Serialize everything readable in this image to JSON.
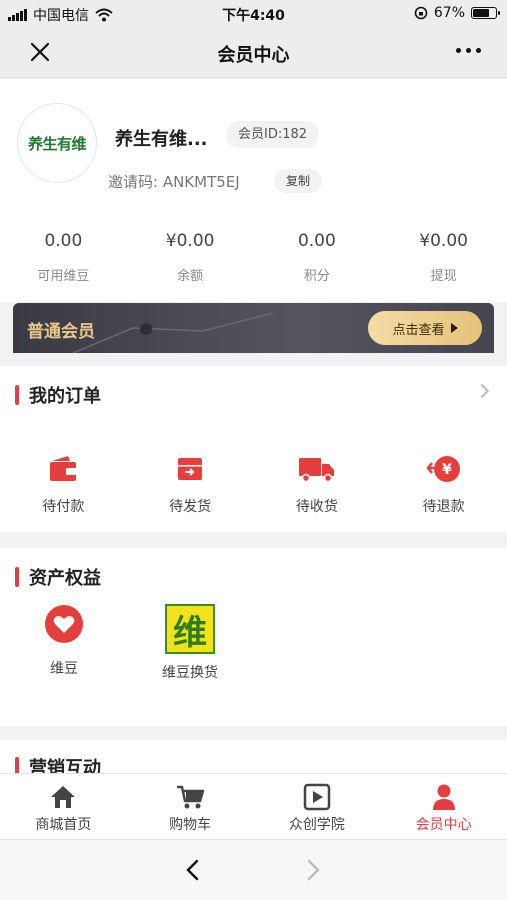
{
  "status_bar": {
    "carrier": "中国电信",
    "time": "下午4:40",
    "battery": "67%",
    "battery_level": 0.67
  },
  "nav": {
    "title": "会员中心",
    "close_icon": "close-icon",
    "more_icon": "more-icon"
  },
  "profile": {
    "avatar_text": "养生有维",
    "nickname": "养生有维...",
    "member_id": "会员ID:182",
    "invite": "邀请码: ANKMT5EJ",
    "copy_label": "复制"
  },
  "stats": [
    {
      "value": "0.00",
      "label": "可用维豆"
    },
    {
      "value": "¥0.00",
      "label": "余额"
    },
    {
      "value": "0.00",
      "label": "积分"
    },
    {
      "value": "¥0.00",
      "label": "提现"
    }
  ],
  "vip": {
    "label": "普通会员",
    "button": "点击查看"
  },
  "orders": {
    "title": "我的订单",
    "items": [
      {
        "label": "待付款",
        "icon": "wallet-icon"
      },
      {
        "label": "待发货",
        "icon": "box-icon"
      },
      {
        "label": "待收货",
        "icon": "truck-icon"
      },
      {
        "label": "待退款",
        "icon": "refund-icon"
      }
    ]
  },
  "assets": {
    "title": "资产权益",
    "items": [
      {
        "label": "维豆",
        "icon": "heart-icon"
      },
      {
        "label": "维豆换货",
        "icon": "wei-logo-icon",
        "logo_text": "维"
      }
    ]
  },
  "marketing": {
    "title": "营销互动"
  },
  "tabs": [
    {
      "label": "商城首页",
      "icon": "home-icon"
    },
    {
      "label": "购物车",
      "icon": "cart-icon"
    },
    {
      "label": "众创学院",
      "icon": "play-icon"
    },
    {
      "label": "会员中心",
      "icon": "user-icon",
      "active": true
    }
  ],
  "colors": {
    "accent": "#e43f3f",
    "gold": "#e8c88a",
    "banner_dark": "#3a3a45"
  }
}
